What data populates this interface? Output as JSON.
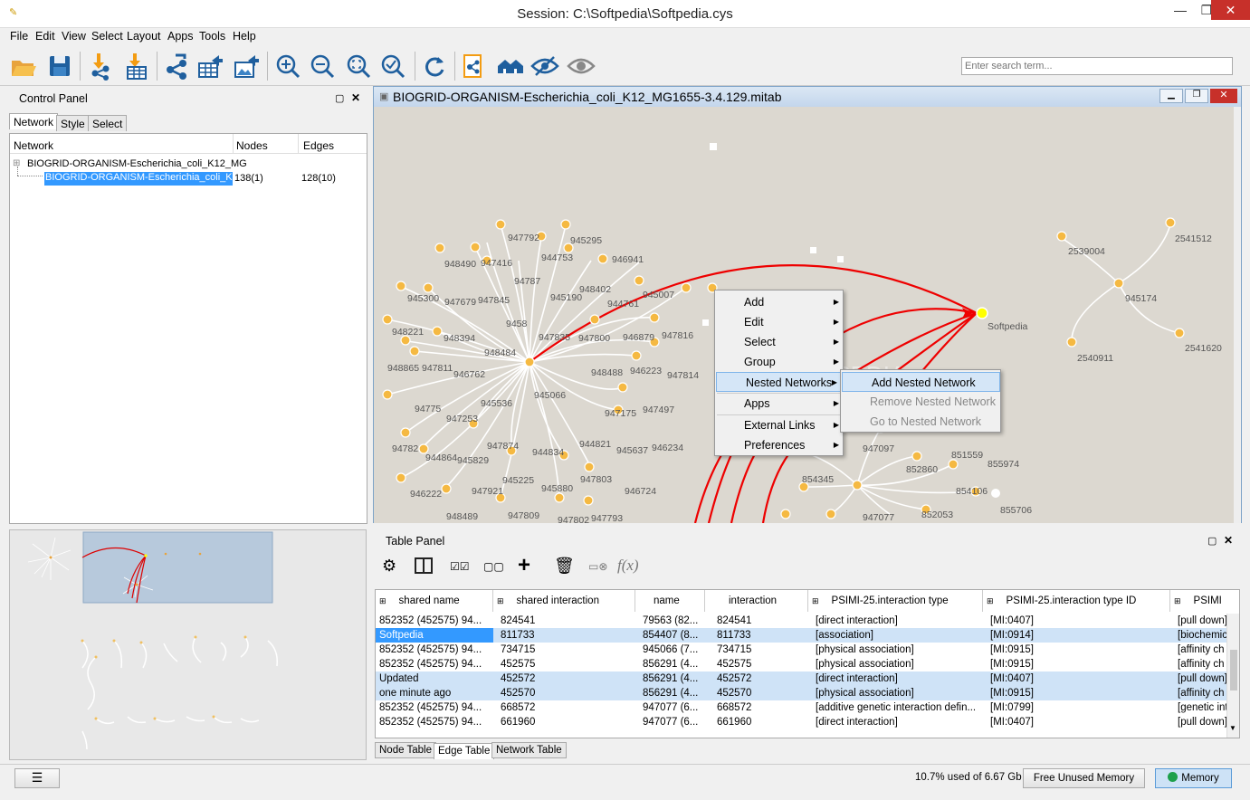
{
  "window": {
    "title": "Session: C:\\Softpedia\\Softpedia.cys"
  },
  "menubar": [
    "File",
    "Edit",
    "View",
    "Select",
    "Layout",
    "Apps",
    "Tools",
    "Help"
  ],
  "search": {
    "placeholder": "Enter search term..."
  },
  "toolbar_icons": [
    "open-session-icon",
    "save-session-icon",
    "import-network-icon",
    "import-table-icon",
    "share-network-icon",
    "export-table-icon",
    "export-image-icon",
    "zoom-in-icon",
    "zoom-out-icon",
    "zoom-fit-icon",
    "zoom-selected-icon",
    "refresh-icon",
    "new-network-icon",
    "home-icon",
    "hide-icon",
    "show-icon"
  ],
  "control_panel": {
    "title": "Control Panel",
    "tabs": [
      "Network",
      "Style",
      "Select"
    ],
    "columns": [
      "Network",
      "Nodes",
      "Edges"
    ],
    "collection": "BIOGRID-ORGANISM-Escherichia_coli_K12_MG",
    "network": {
      "name": "BIOGRID-ORGANISM-Escherichia_coli_K12...",
      "nodes": "138(1)",
      "edges": "128(10)"
    }
  },
  "network_view": {
    "title": "BIOGRID-ORGANISM-Escherichia_coli_K12_MG1655-3.4.129.mitab",
    "watermark": "SOFTPEDIA",
    "labels": {
      "n947792": "947792",
      "n945295": "945295",
      "n948490": "948490",
      "n947416": "947416",
      "n944753": "944753",
      "n946941": "946941",
      "n945300": "945300",
      "n947679": "947679",
      "n947845": "947845",
      "n947873": "94787",
      "n945190": "945190",
      "n948402": "948402",
      "n944761": "944761",
      "n945007": "945007",
      "n948221": "948221",
      "n9458": "9458",
      "n947835": "947835",
      "n947800": "947800",
      "n946879": "946879",
      "n947816": "947816",
      "n948394": "948394",
      "n948484": "948484",
      "n948865": "948865",
      "n947811": "947811",
      "n946762": "946762",
      "n948488": "948488",
      "n946223": "946223",
      "n947814": "947814",
      "n945536": "945536",
      "n945066": "945066",
      "n947757": "94775",
      "n947253": "947253",
      "n947175": "947175",
      "n947497": "947497",
      "n947828": "94782",
      "n947874": "947874",
      "n944834": "944834",
      "n944821": "944821",
      "n945637": "945637",
      "n946234": "946234",
      "n944864": "944864",
      "n945829": "945829",
      "n945225": "945225",
      "n947803": "947803",
      "n946222": "946222",
      "n947921": "947921",
      "n945880": "945880",
      "n946724": "946724",
      "n948489": "948489",
      "n947809": "947809",
      "n947802": "947802",
      "n947793": "947793",
      "softpedia": "Softpedia",
      "n2539004": "2539004",
      "n2541512": "2541512",
      "n945174": "945174",
      "n2540911": "2540911",
      "n2541620": "2541620",
      "n947097": "947097",
      "n851559": "851559",
      "n855974": "855974",
      "n852860": "852860",
      "n854345": "854345",
      "n854106": "854106",
      "n855706": "855706",
      "n947077": "947077",
      "n852053": "852053"
    }
  },
  "context_menu": {
    "items": [
      "Add",
      "Edit",
      "Select",
      "Group",
      "Nested Networks",
      "Apps",
      "External Links",
      "Preferences"
    ],
    "submenu": [
      "Add Nested Network",
      "Remove Nested Network",
      "Go to Nested Network"
    ]
  },
  "table_panel": {
    "title": "Table Panel",
    "toolbar_icons": [
      "settings-icon",
      "columns-icon",
      "select-all-icon",
      "deselect-all-icon",
      "add-icon",
      "delete-icon",
      "link-icon",
      "function-icon"
    ],
    "function_label": "f(x)",
    "columns": [
      "shared name",
      "shared interaction",
      "name",
      "interaction",
      "PSIMI-25.interaction type",
      "PSIMI-25.interaction type ID",
      "PSIMI"
    ],
    "rows": [
      [
        "852352 (452575) 94...",
        "824541",
        "79563 (82...",
        "824541",
        "[direct interaction]",
        "[MI:0407]",
        "[pull down]"
      ],
      [
        "Softpedia",
        "811733",
        "854407 (8...",
        "811733",
        "[association]",
        "[MI:0914]",
        "[biochemica"
      ],
      [
        "852352 (452575) 94...",
        "734715",
        "945066 (7...",
        "734715",
        "[physical association]",
        "[MI:0915]",
        "[affinity ch"
      ],
      [
        "852352 (452575) 94...",
        "452575",
        "856291 (4...",
        "452575",
        "[physical association]",
        "[MI:0915]",
        "[affinity ch"
      ],
      [
        "Updated",
        "452572",
        "856291 (4...",
        "452572",
        "[direct interaction]",
        "[MI:0407]",
        "[pull down]"
      ],
      [
        "one minute ago",
        "452570",
        "856291 (4...",
        "452570",
        "[physical association]",
        "[MI:0915]",
        "[affinity ch"
      ],
      [
        "852352 (452575) 94...",
        "668572",
        "947077 (6...",
        "668572",
        "[additive genetic interaction defin...",
        "[MI:0799]",
        "[genetic int"
      ],
      [
        "852352 (452575) 94...",
        "661960",
        "947077 (6...",
        "661960",
        "[direct interaction]",
        "[MI:0407]",
        "[pull down]"
      ]
    ],
    "bottom_tabs": [
      "Node Table",
      "Edge Table",
      "Network Table"
    ]
  },
  "status": {
    "memory_text": "10.7% used of 6.67 Gb",
    "free_button": "Free Unused Memory",
    "memory_button": "Memory"
  },
  "colors": {
    "selection": "#3399ff",
    "row_highlight": "#cfe3f7",
    "edge_red": "#e00000",
    "node_orange": "#f5b942",
    "node_selected": "#ffff00"
  }
}
